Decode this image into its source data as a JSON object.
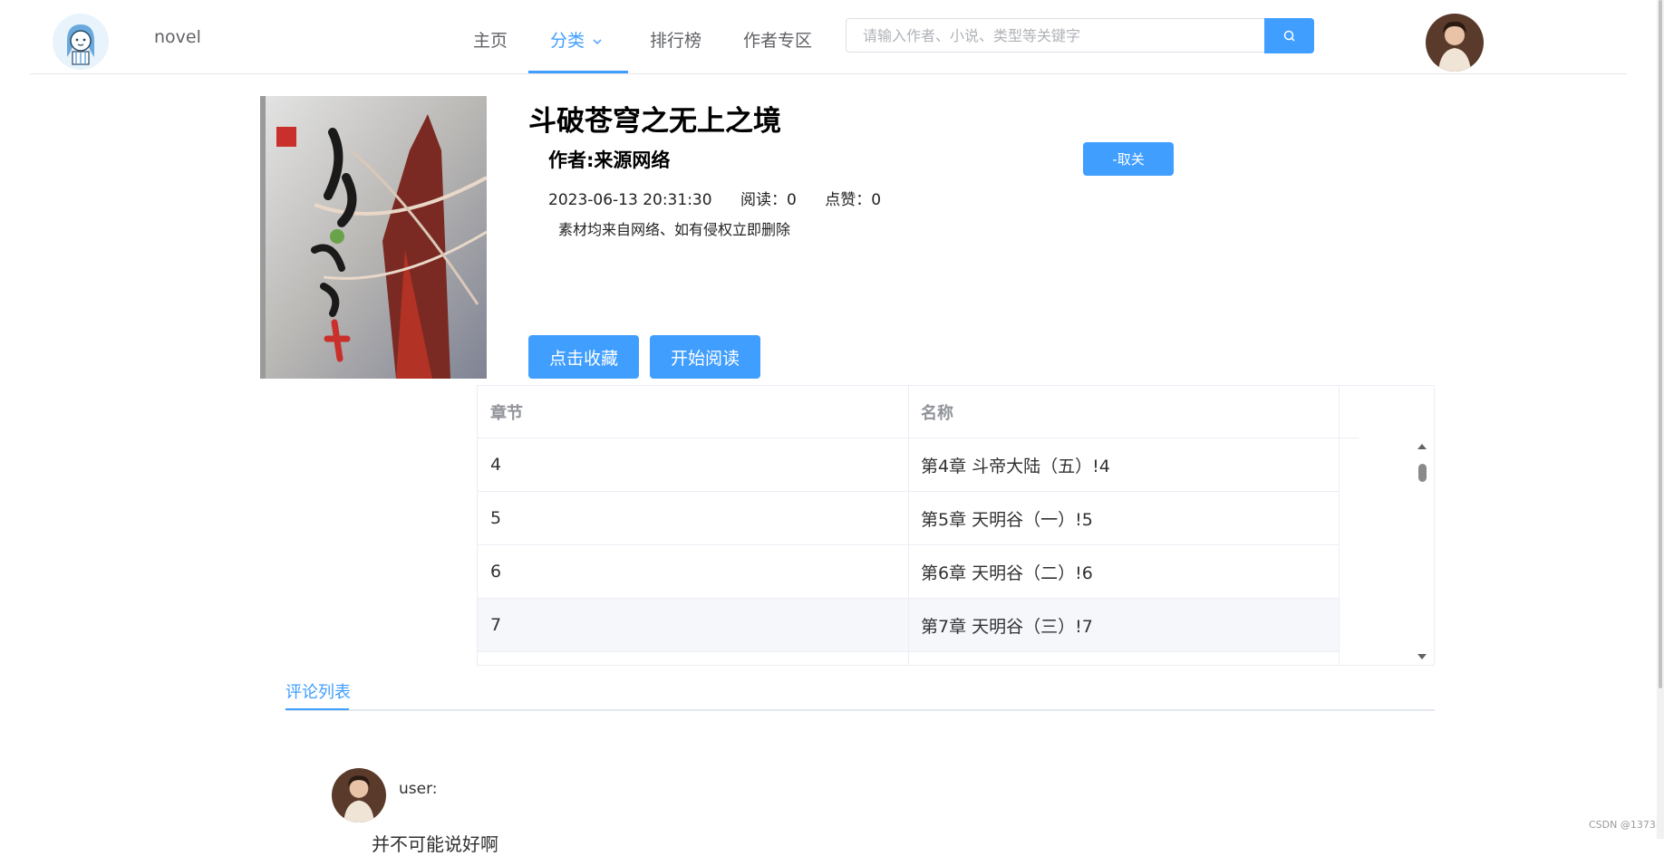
{
  "header": {
    "brand": "novel",
    "nav": [
      {
        "label": "主页",
        "active": false
      },
      {
        "label": "分类",
        "active": true
      },
      {
        "label": "排行榜",
        "active": false
      },
      {
        "label": "作者专区",
        "active": false
      }
    ],
    "search_placeholder": "请输入作者、小说、类型等关键字",
    "search_value": ""
  },
  "book": {
    "title": "斗破苍穹之无上之境",
    "author": "作者:来源网络",
    "datetime": "2023-06-13 20:31:30",
    "reads": "阅读：0",
    "likes": "点赞：0",
    "description": "素材均来自网络、如有侵权立即删除",
    "unfollow_label": "-取关",
    "collect_label": "点击收藏",
    "read_label": "开始阅读"
  },
  "chapters": {
    "columns": [
      "章节",
      "名称"
    ],
    "rows": [
      {
        "chapter": "4",
        "name": "第4章 斗帝大陆（五）!4"
      },
      {
        "chapter": "5",
        "name": "第5章 天明谷（一）!5"
      },
      {
        "chapter": "6",
        "name": "第6章 天明谷（二）!6"
      },
      {
        "chapter": "7",
        "name": "第7章 天明谷（三）!7",
        "highlighted": true
      }
    ]
  },
  "comments": {
    "tab_label": "评论列表",
    "items": [
      {
        "user": "user:",
        "text": "并不可能说好啊"
      }
    ]
  },
  "watermark": "CSDN @1373i",
  "colors": {
    "accent": "#409eff",
    "border": "#ebeef5",
    "muted": "#909399"
  },
  "icons": {
    "search": "search-icon",
    "chevron": "chevron-down-icon"
  }
}
